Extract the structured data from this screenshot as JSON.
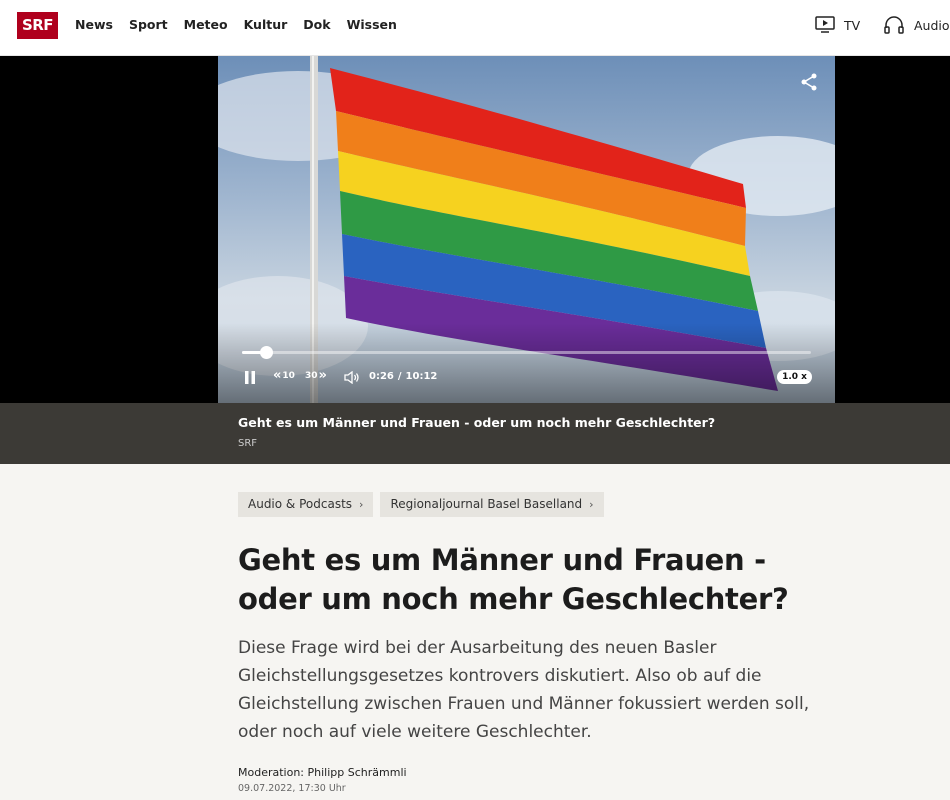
{
  "header": {
    "logo_text": "SRF",
    "nav": [
      "News",
      "Sport",
      "Meteo",
      "Kultur",
      "Dok",
      "Wissen"
    ],
    "tv_label": "TV",
    "audio_label": "Audio"
  },
  "player": {
    "current_time": "0:26",
    "separator": "/",
    "duration": "10:12",
    "rewind_label": "10",
    "forward_label": "30",
    "speed_label": "1.0 x",
    "progress_fraction": 0.042
  },
  "caption": {
    "title": "Geht es um Männer und Frauen - oder um noch mehr Geschlechter?",
    "source": "SRF"
  },
  "breadcrumbs": [
    {
      "label": "Audio & Podcasts"
    },
    {
      "label": "Regionaljournal Basel Baselland"
    }
  ],
  "article": {
    "title": "Geht es um Männer und Frauen - oder um noch mehr Geschlechter?",
    "lead": "Diese Frage wird bei der Ausarbeitung des neuen Basler Gleichstellungsgesetzes kontrovers diskutiert. Also ob auf die Gleichstellung zwischen Frauen und Männer fokussiert werden soll, oder noch auf viele weitere Geschlechter.",
    "moderation": "Moderation: Philipp Schrämmli",
    "date": "09.07.2022, 17:30 Uhr"
  },
  "colors": {
    "brand": "#af001d",
    "caption_bg": "#3c3a36",
    "page_bg": "#f6f5f2"
  }
}
